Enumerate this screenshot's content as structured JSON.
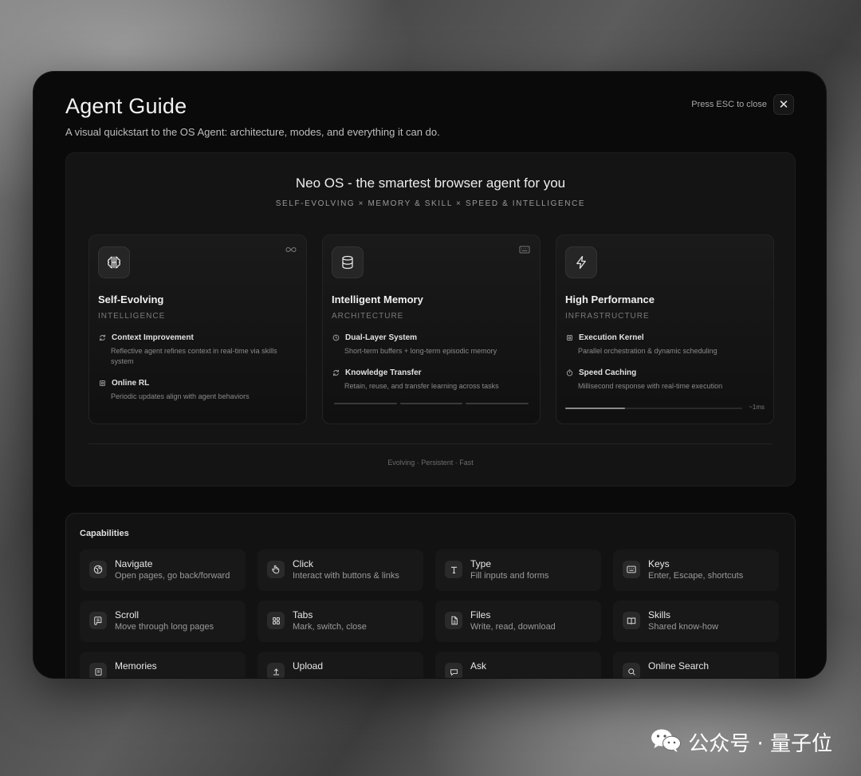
{
  "modal": {
    "title": "Agent Guide",
    "subtitle": "A visual quickstart to the OS Agent: architecture, modes, and everything it can do.",
    "esc_hint": "Press ESC to close",
    "close_icon": "close-icon"
  },
  "hero": {
    "title": "Neo OS - the smartest browser agent for you",
    "tagline": "SELF-EVOLVING × MEMORY & SKILL × SPEED & INTELLIGENCE",
    "footer": "Evolving · Persistent · Fast",
    "pillars": [
      {
        "name": "Self-Evolving",
        "category": "INTELLIGENCE",
        "icon": "brain-icon",
        "corner_icon": "infinity-icon",
        "features": [
          {
            "title": "Context Improvement",
            "desc": "Reflective agent refines context in real-time via skills system",
            "icon": "refresh-icon"
          },
          {
            "title": "Online RL",
            "desc": "Periodic updates align with agent behaviors",
            "icon": "cpu-icon"
          }
        ]
      },
      {
        "name": "Intelligent Memory",
        "category": "ARCHITECTURE",
        "icon": "database-icon",
        "corner_icon": "keyboard-icon",
        "features": [
          {
            "title": "Dual-Layer System",
            "desc": "Short-term buffers + long-term episodic memory",
            "icon": "clock-icon"
          },
          {
            "title": "Knowledge Transfer",
            "desc": "Retain, reuse, and transfer learning across tasks",
            "icon": "refresh-icon"
          }
        ]
      },
      {
        "name": "High Performance",
        "category": "INFRASTRUCTURE",
        "icon": "lightning-icon",
        "features": [
          {
            "title": "Execution Kernel",
            "desc": "Parallel orchestration & dynamic scheduling",
            "icon": "cpu-icon"
          },
          {
            "title": "Speed Caching",
            "desc": "Millisecond response with real-time execution",
            "icon": "timer-icon"
          }
        ],
        "latency_label": "~1ms",
        "progress": 0.34
      }
    ]
  },
  "capabilities": {
    "title": "Capabilities",
    "items": [
      {
        "name": "Navigate",
        "desc": "Open pages, go back/forward",
        "icon": "globe-icon"
      },
      {
        "name": "Click",
        "desc": "Interact with buttons & links",
        "icon": "pointer-icon"
      },
      {
        "name": "Type",
        "desc": "Fill inputs and forms",
        "icon": "text-icon"
      },
      {
        "name": "Keys",
        "desc": "Enter, Escape, shortcuts",
        "icon": "keyboard-icon"
      },
      {
        "name": "Scroll",
        "desc": "Move through long pages",
        "icon": "scroll-icon"
      },
      {
        "name": "Tabs",
        "desc": "Mark, switch, close",
        "icon": "grid-icon"
      },
      {
        "name": "Files",
        "desc": "Write, read, download",
        "icon": "file-icon"
      },
      {
        "name": "Skills",
        "desc": "Shared know-how",
        "icon": "book-icon"
      },
      {
        "name": "Memories",
        "desc": "",
        "icon": "note-icon"
      },
      {
        "name": "Upload",
        "desc": "",
        "icon": "upload-icon"
      },
      {
        "name": "Ask",
        "desc": "",
        "icon": "chat-icon"
      },
      {
        "name": "Online Search",
        "desc": "",
        "icon": "search-icon"
      }
    ]
  },
  "watermark": {
    "text": "公众号 · 量子位",
    "icon": "wechat-icon"
  },
  "colors": {
    "modal_bg": "#0a0a0a",
    "panel_bg": "#141414",
    "text_primary": "#f0f0f0",
    "text_muted": "#8a8a8a"
  }
}
